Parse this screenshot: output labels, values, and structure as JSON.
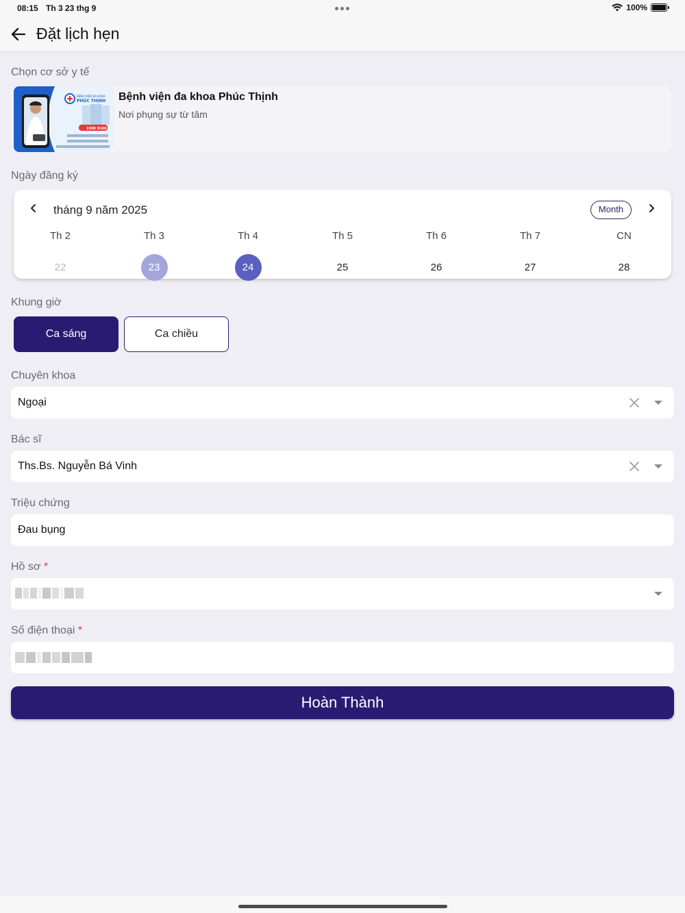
{
  "status_bar": {
    "time": "08:15",
    "date": "Th 3 23 thg 9",
    "battery": "100%"
  },
  "header": {
    "title": "Đặt lịch hẹn"
  },
  "facility_section": {
    "label": "Chọn cơ sở y tế",
    "name": "Bệnh viện đa khoa Phúc Thịnh",
    "slogan": "Nơi phụng sự từ tâm",
    "thumb": {
      "brand": "PHÚC THỊNH",
      "phone": "1900 8108"
    }
  },
  "date_section": {
    "label": "Ngày đăng ký",
    "month_title": "tháng 9 năm 2025",
    "view_mode": "Month",
    "days": [
      {
        "weekday": "Th 2",
        "date": "22",
        "state": "past"
      },
      {
        "weekday": "Th 3",
        "date": "23",
        "state": "today"
      },
      {
        "weekday": "Th 4",
        "date": "24",
        "state": "selected"
      },
      {
        "weekday": "Th 5",
        "date": "25",
        "state": "normal"
      },
      {
        "weekday": "Th 6",
        "date": "26",
        "state": "normal"
      },
      {
        "weekday": "Th 7",
        "date": "27",
        "state": "normal"
      },
      {
        "weekday": "CN",
        "date": "28",
        "state": "normal"
      }
    ]
  },
  "shift_section": {
    "label": "Khung giờ",
    "morning": "Ca sáng",
    "afternoon": "Ca chiều",
    "selected": "Ca sáng"
  },
  "specialty": {
    "label": "Chuyên khoa",
    "value": "Ngoại"
  },
  "doctor": {
    "label": "Bác sĩ",
    "value": "Ths.Bs. Nguyễn Bá Vinh"
  },
  "symptom": {
    "label": "Triệu chứng",
    "value": "Đau bụng"
  },
  "profile": {
    "label": "Hồ sơ",
    "required": "*"
  },
  "phone": {
    "label": "Số điện thoại",
    "required": "*"
  },
  "submit": {
    "label": "Hoàn Thành"
  },
  "colors": {
    "primary": "#2a1b72",
    "selected_day": "#5b5fc0",
    "today_day": "#a3a6db",
    "background": "#efeef4"
  }
}
